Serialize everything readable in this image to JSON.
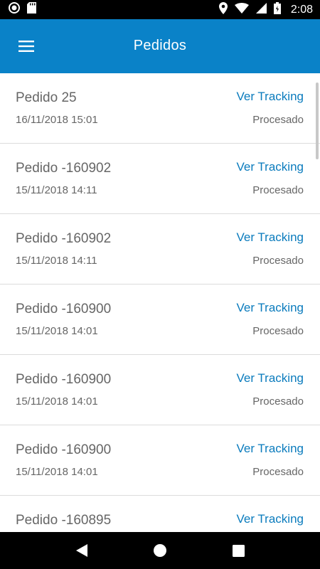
{
  "status_bar": {
    "time": "2:08",
    "icons": [
      "app-notification-icon",
      "sd-card-icon",
      "location-icon",
      "wifi-icon",
      "signal-icon",
      "battery-icon"
    ]
  },
  "app_bar": {
    "title": "Pedidos",
    "menu_icon": "hamburger-menu-icon",
    "color": "#0a82c8"
  },
  "orders": [
    {
      "title": "Pedido 25",
      "date": "16/11/2018 15:01",
      "link": "Ver Tracking",
      "status": "Procesado"
    },
    {
      "title": "Pedido -160902",
      "date": "15/11/2018 14:11",
      "link": "Ver Tracking",
      "status": "Procesado"
    },
    {
      "title": "Pedido -160902",
      "date": "15/11/2018 14:11",
      "link": "Ver Tracking",
      "status": "Procesado"
    },
    {
      "title": "Pedido -160900",
      "date": "15/11/2018 14:01",
      "link": "Ver Tracking",
      "status": "Procesado"
    },
    {
      "title": "Pedido -160900",
      "date": "15/11/2018 14:01",
      "link": "Ver Tracking",
      "status": "Procesado"
    },
    {
      "title": "Pedido -160900",
      "date": "15/11/2018 14:01",
      "link": "Ver Tracking",
      "status": "Procesado"
    },
    {
      "title": "Pedido -160895",
      "date": "",
      "link": "Ver Tracking",
      "status": ""
    }
  ],
  "nav_bar": {
    "icons": [
      "back-icon",
      "home-icon",
      "recents-icon"
    ]
  },
  "colors": {
    "accent": "#0a82c8",
    "link": "#0a7bbd",
    "text_secondary": "#666666"
  }
}
